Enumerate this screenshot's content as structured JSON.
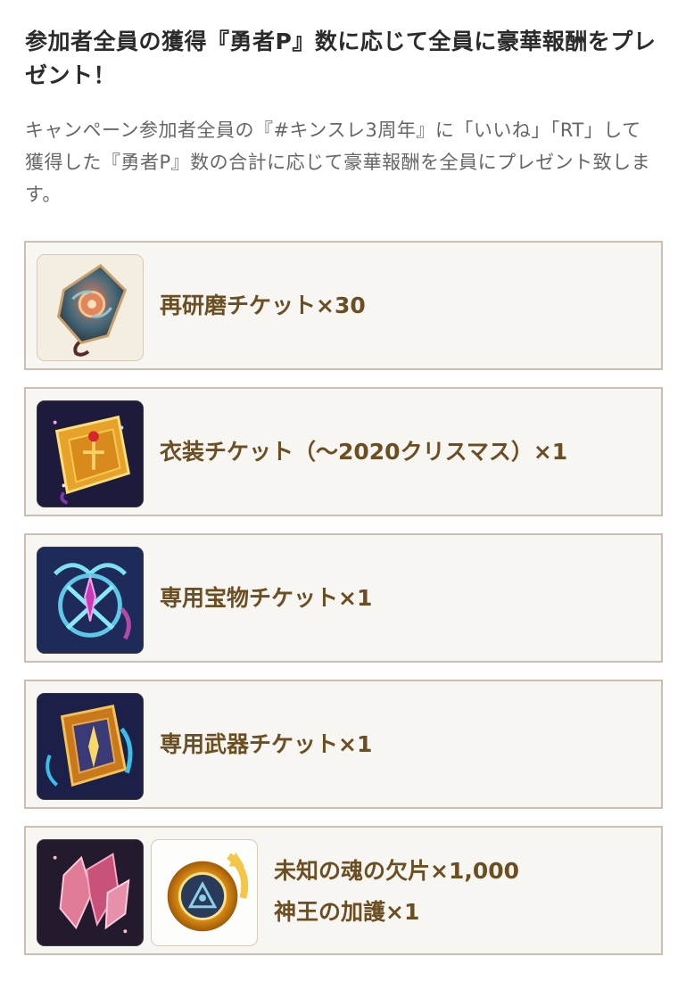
{
  "section": {
    "title": "参加者全員の獲得『勇者P』数に応じて全員に豪華報酬をプレゼント！",
    "description": "キャンペーン参加者全員の『#キンスレ3周年』に「いいね」「RT」して獲得した『勇者P』数の合計に応じて豪華報酬を全員にプレゼント致します。"
  },
  "rewards": [
    {
      "icon": "polish-ticket-icon",
      "label": "再研磨チケット×30"
    },
    {
      "icon": "costume-ticket-icon",
      "label": "衣装チケット（〜2020クリスマス）×1"
    },
    {
      "icon": "treasure-ticket-icon",
      "label": "専用宝物チケット×1"
    },
    {
      "icon": "weapon-ticket-icon",
      "label": "専用武器チケット×1"
    },
    {
      "icons": [
        "soul-shard-icon",
        "god-king-blessing-icon"
      ],
      "labels": [
        "未知の魂の欠片×1,000",
        "神王の加護×1"
      ]
    }
  ],
  "colors": {
    "card_border": "#cdbfb0",
    "card_background": "#f8f6f3",
    "reward_text": "#6b4f22"
  }
}
